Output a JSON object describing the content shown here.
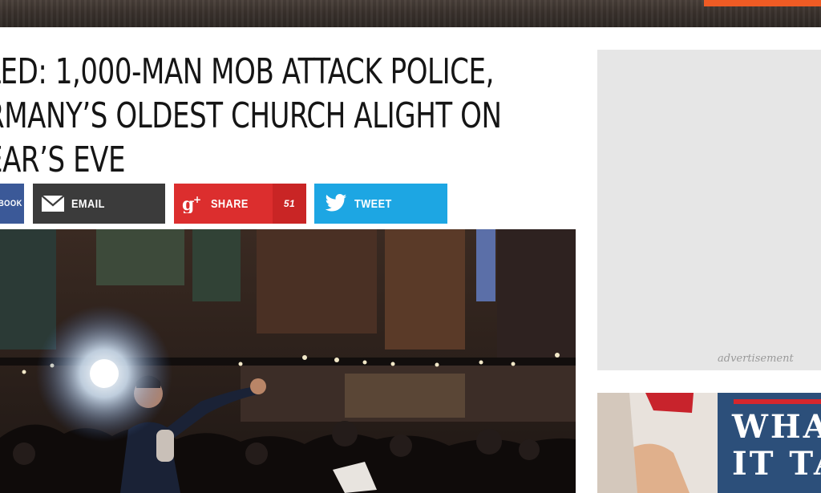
{
  "header": {
    "accent_color": "#ef5b24"
  },
  "article": {
    "headline_lines": [
      "LED: 1,000-MAN MOB ATTACK POLICE,",
      "RMANY’S OLDEST CHURCH ALIGHT ON",
      "EAR’S EVE"
    ]
  },
  "share": {
    "facebook_label": "BOOK",
    "email_label": "EMAIL",
    "gplus_label": "SHARE",
    "gplus_count": "51",
    "twitter_label": "TWEET",
    "colors": {
      "facebook": "#3b5998",
      "email": "#3b3b3b",
      "gplus": "#dc2e2e",
      "twitter": "#1da6e3"
    }
  },
  "icons": {
    "email": "envelope-icon",
    "gplus": "google-plus-icon",
    "twitter": "twitter-bird-icon"
  },
  "sidebar": {
    "ad_label": "advertisement",
    "promo_lines": [
      "WHAT",
      "IT TA"
    ]
  }
}
